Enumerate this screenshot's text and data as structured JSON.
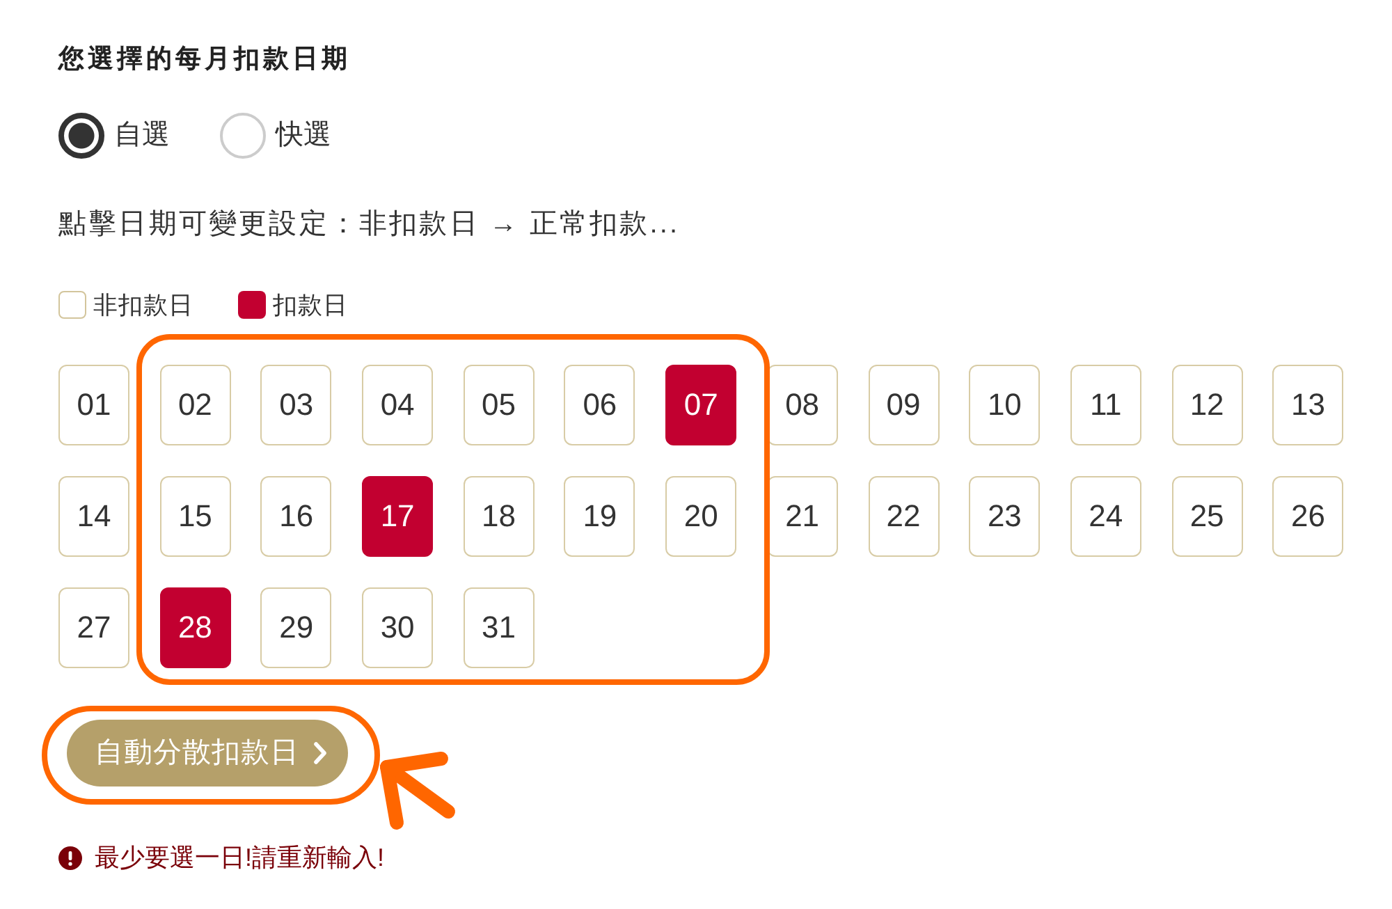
{
  "title": "您選擇的每月扣款日期",
  "mode_options": [
    {
      "label": "自選",
      "selected": true
    },
    {
      "label": "快選",
      "selected": false
    }
  ],
  "instruction": "點擊日期可變更設定：非扣款日 → 正常扣款...",
  "legend": [
    {
      "label": "非扣款日",
      "kind": "off"
    },
    {
      "label": "扣款日",
      "kind": "on"
    }
  ],
  "days": [
    {
      "label": "01",
      "selected": false
    },
    {
      "label": "02",
      "selected": false
    },
    {
      "label": "03",
      "selected": false
    },
    {
      "label": "04",
      "selected": false
    },
    {
      "label": "05",
      "selected": false
    },
    {
      "label": "06",
      "selected": false
    },
    {
      "label": "07",
      "selected": true
    },
    {
      "label": "08",
      "selected": false
    },
    {
      "label": "09",
      "selected": false
    },
    {
      "label": "10",
      "selected": false
    },
    {
      "label": "11",
      "selected": false
    },
    {
      "label": "12",
      "selected": false
    },
    {
      "label": "13",
      "selected": false
    },
    {
      "label": "14",
      "selected": false
    },
    {
      "label": "15",
      "selected": false
    },
    {
      "label": "16",
      "selected": false
    },
    {
      "label": "17",
      "selected": true
    },
    {
      "label": "18",
      "selected": false
    },
    {
      "label": "19",
      "selected": false
    },
    {
      "label": "20",
      "selected": false
    },
    {
      "label": "21",
      "selected": false
    },
    {
      "label": "22",
      "selected": false
    },
    {
      "label": "23",
      "selected": false
    },
    {
      "label": "24",
      "selected": false
    },
    {
      "label": "25",
      "selected": false
    },
    {
      "label": "26",
      "selected": false
    },
    {
      "label": "27",
      "selected": false
    },
    {
      "label": "28",
      "selected": true
    },
    {
      "label": "29",
      "selected": false
    },
    {
      "label": "30",
      "selected": false
    },
    {
      "label": "31",
      "selected": false
    }
  ],
  "auto_button": {
    "label": "自動分散扣款日"
  },
  "error": {
    "text": "最少要選一日!請重新輸入!"
  },
  "annotations": [
    {
      "kind": "frame"
    },
    {
      "kind": "ring"
    },
    {
      "kind": "arrow"
    }
  ]
}
